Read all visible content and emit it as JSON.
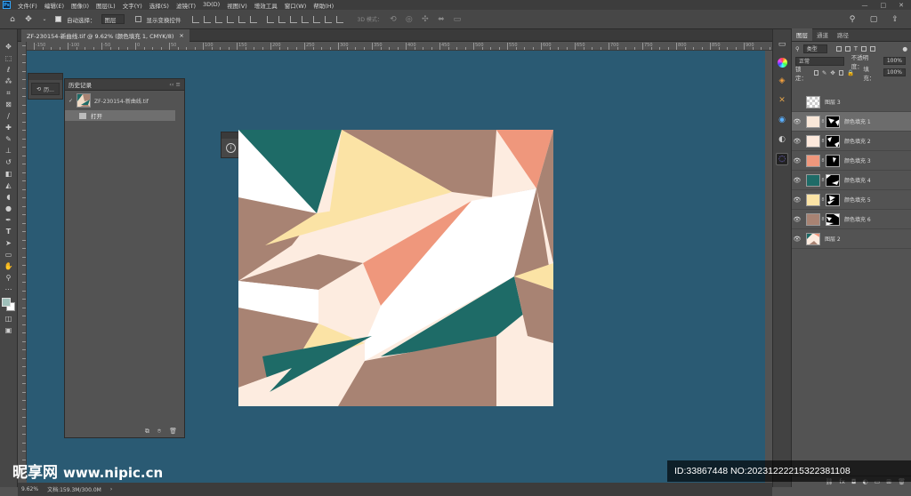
{
  "menubar": {
    "logo": "Ps",
    "items": [
      "文件(F)",
      "编辑(E)",
      "图像(I)",
      "图层(L)",
      "文字(Y)",
      "选择(S)",
      "滤镜(T)",
      "3D(D)",
      "视图(V)",
      "增效工具",
      "窗口(W)",
      "帮助(H)"
    ],
    "window_buttons": [
      "—",
      "□",
      "✕"
    ]
  },
  "options": {
    "auto_select_label": "自动选择：",
    "auto_select_target": "图层",
    "show_transform_label": "显示变换控件",
    "mode_3d": "3D 模式："
  },
  "document_tab": {
    "title": "ZF-230154-新曲线.tif @ 9.62% (颜色填充 1, CMYK/8)",
    "close": "×"
  },
  "ruler_labels": [
    "-150",
    "-100",
    "-50",
    "0",
    "50",
    "100",
    "150",
    "200",
    "250",
    "300",
    "350",
    "400",
    "450",
    "500",
    "550",
    "600",
    "650",
    "700",
    "750",
    "800",
    "850",
    "900"
  ],
  "history_mini": {
    "label": "历..."
  },
  "history_panel": {
    "title": "历史记录",
    "controls": "‹‹ ≡",
    "snapshot_name": "ZF-230154-新曲线.tif",
    "steps": [
      "打开"
    ]
  },
  "layers_panel": {
    "tabs": [
      "图层",
      "通道",
      "路径"
    ],
    "filter_type": "类型",
    "blend_mode": "正常",
    "opacity_label": "不透明度：",
    "opacity_value": "100%",
    "lock_label": "锁定：",
    "fill_label": "填充：",
    "fill_value": "100%",
    "layers": [
      {
        "name": "图层 3",
        "visible": false,
        "thumb": "checker",
        "mask": false
      },
      {
        "name": "颜色填充 1",
        "visible": true,
        "thumb": "#f9e7d8",
        "mask": true,
        "selected": true
      },
      {
        "name": "颜色填充 2",
        "visible": true,
        "thumb": "#fde9dc",
        "mask": true
      },
      {
        "name": "颜色填充 3",
        "visible": true,
        "thumb": "#ef977c",
        "mask": true
      },
      {
        "name": "颜色填充 4",
        "visible": true,
        "thumb": "#1e6b67",
        "mask": true
      },
      {
        "name": "颜色填充 5",
        "visible": true,
        "thumb": "#fbe3a5",
        "mask": true
      },
      {
        "name": "颜色填充 6",
        "visible": true,
        "thumb": "#a88373",
        "mask": true
      },
      {
        "name": "图层 2",
        "visible": true,
        "thumb": "art",
        "mask": false
      }
    ]
  },
  "status": {
    "zoom": "9.62%",
    "doc_info": "文档:159.3M/300.0M",
    "arrow": "›"
  },
  "colors": {
    "workspace": "#2a5a73",
    "teal": "#1e6b67",
    "brown": "#a88373",
    "salmon": "#ef977c",
    "yellow": "#fbe3a5",
    "cream": "#fdece0",
    "white": "#ffffff"
  },
  "watermark": {
    "brand": "昵享网",
    "url": "www.nipic.cn",
    "id_text": "ID:33867448 NO:20231222215322381108"
  }
}
